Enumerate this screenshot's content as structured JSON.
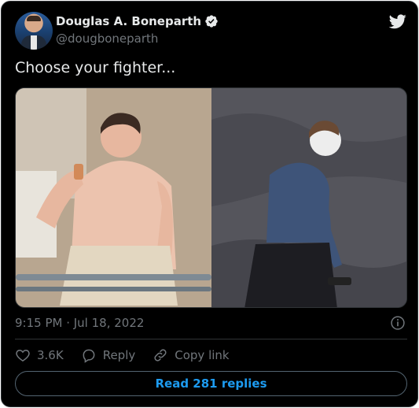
{
  "author": {
    "name": "Douglas A. Boneparth",
    "handle": "@dougboneparth"
  },
  "tweet": {
    "text": "Choose your fighter...",
    "timestamp": "9:15 PM · Jul 18, 2022"
  },
  "media": {
    "photos": [
      "photo-left",
      "photo-right"
    ]
  },
  "actions": {
    "likes_count": "3.6K",
    "reply_label": "Reply",
    "copy_link_label": "Copy link"
  },
  "read_replies_label": "Read 281 replies",
  "colors": {
    "background": "#000000",
    "text": "#e7e9ea",
    "muted": "#71767b",
    "accent": "#1d9bf0",
    "border": "#2f3336"
  },
  "icons": [
    "twitter-bird-icon",
    "verified-badge-icon",
    "info-icon",
    "heart-icon",
    "reply-bubble-icon",
    "link-icon"
  ]
}
